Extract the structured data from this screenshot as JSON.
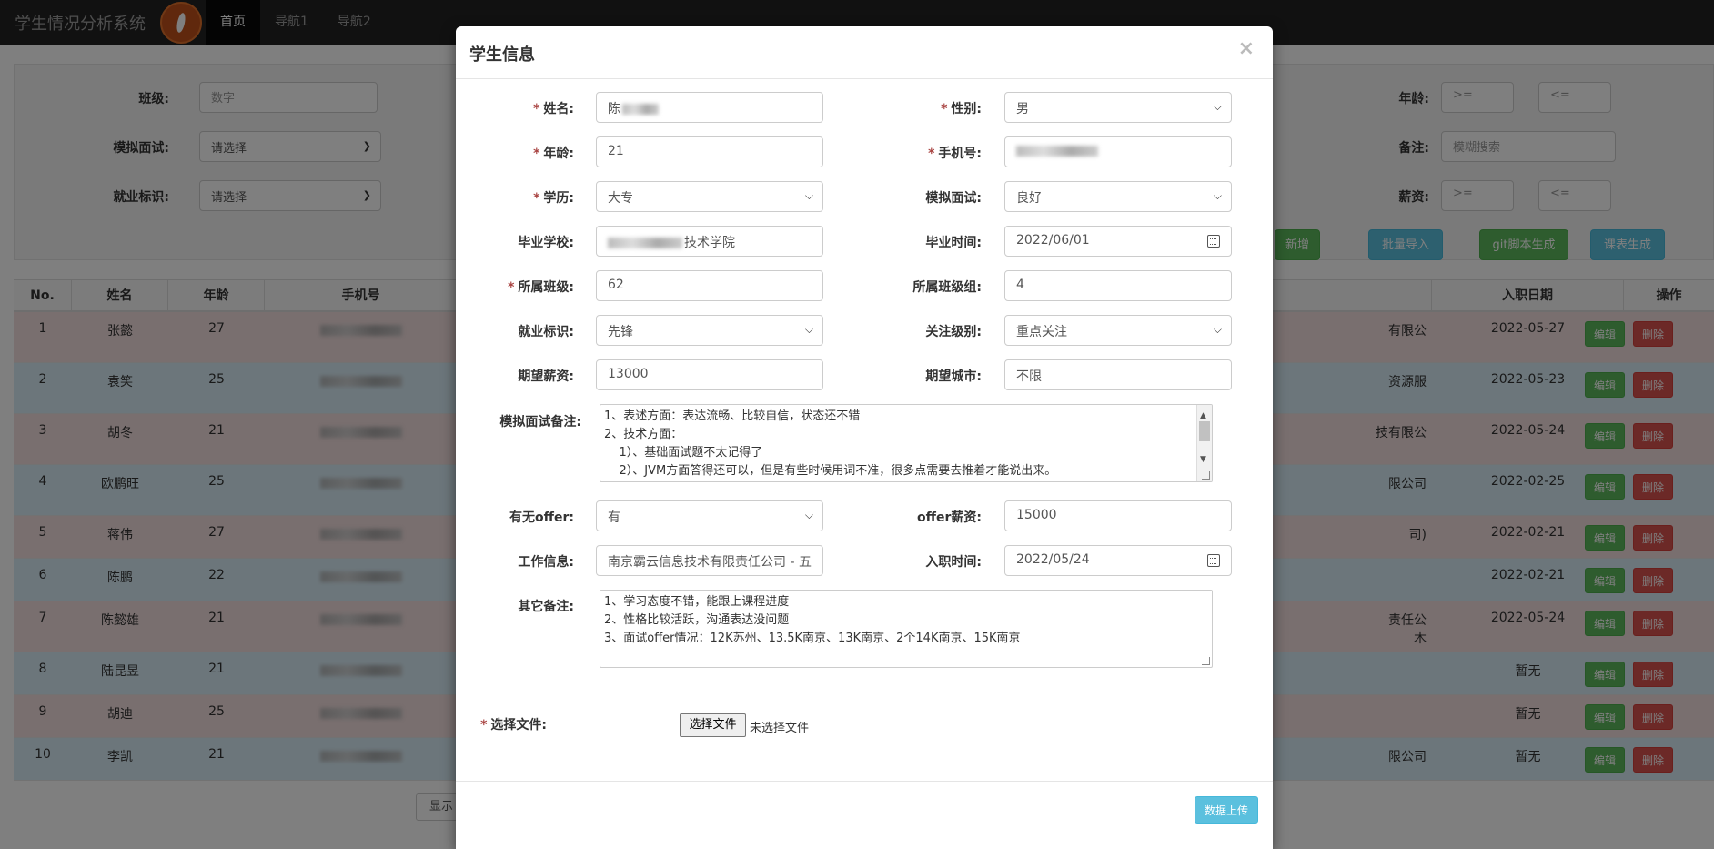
{
  "navbar": {
    "brand": "学生情况分析系统",
    "items": [
      "首页",
      "导航1",
      "导航2"
    ]
  },
  "filter": {
    "class_label": "班级:",
    "class_placeholder": "数字",
    "mock_label": "模拟面试:",
    "mock_value": "请选择",
    "job_label": "就业标识:",
    "job_value": "请选择",
    "age_label": "年龄:",
    "age_ge": ">=",
    "age_le": "<=",
    "note_label": "备注:",
    "note_placeholder": "模糊搜索",
    "salary_label": "薪资:",
    "salary_ge": ">=",
    "salary_le": "<=",
    "btn_add": "新增",
    "btn_import": "批量导入",
    "btn_git": "git脚本生成",
    "btn_schedule": "课表生成"
  },
  "table": {
    "headers": [
      "No.",
      "姓名",
      "年龄",
      "手机号",
      "入职日期",
      "操作"
    ],
    "edit_label": "编辑",
    "delete_label": "删除",
    "rows": [
      {
        "no": "1",
        "name": "张懿",
        "age": "27",
        "company": "有限公",
        "date": "2022-05-27"
      },
      {
        "no": "2",
        "name": "袁笑",
        "age": "25",
        "company": "资源服",
        "date": "2022-05-23"
      },
      {
        "no": "3",
        "name": "胡冬",
        "age": "21",
        "company": "技有限公",
        "date": "2022-05-24"
      },
      {
        "no": "4",
        "name": "欧鹏旺",
        "age": "25",
        "company": "限公司",
        "date": "2022-02-25"
      },
      {
        "no": "5",
        "name": "蒋伟",
        "age": "27",
        "company": "司)",
        "date": "2022-02-21"
      },
      {
        "no": "6",
        "name": "陈鹏",
        "age": "22",
        "company": "",
        "date": "2022-02-21"
      },
      {
        "no": "7",
        "name": "陈懿雄",
        "age": "21",
        "company": "责任公\n木",
        "date": "2022-05-24"
      },
      {
        "no": "8",
        "name": "陆昆昱",
        "age": "21",
        "company": "",
        "date": "暂无"
      },
      {
        "no": "9",
        "name": "胡迪",
        "age": "25",
        "company": "",
        "date": "暂无"
      },
      {
        "no": "10",
        "name": "李凯",
        "age": "21",
        "company": "限公司",
        "date": "暂无"
      }
    ],
    "pagination_label": "显示"
  },
  "modal": {
    "title": "学生信息",
    "close": "×",
    "name_label": "姓名:",
    "name_value": "陈",
    "gender_label": "性别:",
    "gender_value": "男",
    "age_label": "年龄:",
    "age_value": "21",
    "phone_label": "手机号:",
    "edu_label": "学历:",
    "edu_value": "大专",
    "mock_label": "模拟面试:",
    "mock_value": "良好",
    "school_label": "毕业学校:",
    "school_value": "技术学院",
    "grad_label": "毕业时间:",
    "grad_value": "2022/06/01",
    "class_label": "所属班级:",
    "class_value": "62",
    "group_label": "所属班级组:",
    "group_value": "4",
    "job_label": "就业标识:",
    "job_value": "先锋",
    "focus_label": "关注级别:",
    "focus_value": "重点关注",
    "exp_salary_label": "期望薪资:",
    "exp_salary_value": "13000",
    "exp_city_label": "期望城市:",
    "exp_city_value": "不限",
    "mock_note_label": "模拟面试备注:",
    "mock_note_lines": [
      "1、表述方面：表达流畅、比较自信，状态还不错",
      "2、技术方面：",
      "    1）、基础面试题不太记得了",
      "    2）、JVM方面答得还可以，但是有些时候用词不准，很多点需要去推着才能说出来。"
    ],
    "offer_label": "有无offer:",
    "offer_value": "有",
    "offer_salary_label": "offer薪资:",
    "offer_salary_value": "15000",
    "work_label": "工作信息:",
    "work_value": "南京霸云信息技术有限责任公司 - 五",
    "entry_label": "入职时间:",
    "entry_value": "2022/05/24",
    "other_note_label": "其它备注:",
    "other_note_lines": [
      "1、学习态度不错，能跟上课程进度",
      "2、性格比较活跃，沟通表达没问题",
      "3、面试offer情况：12K苏州、13.5K南京、13K南京、2个14K南京、15K南京"
    ],
    "file_label": "选择文件:",
    "file_button": "选择文件",
    "file_status": "未选择文件",
    "upload_button": "数据上传"
  }
}
